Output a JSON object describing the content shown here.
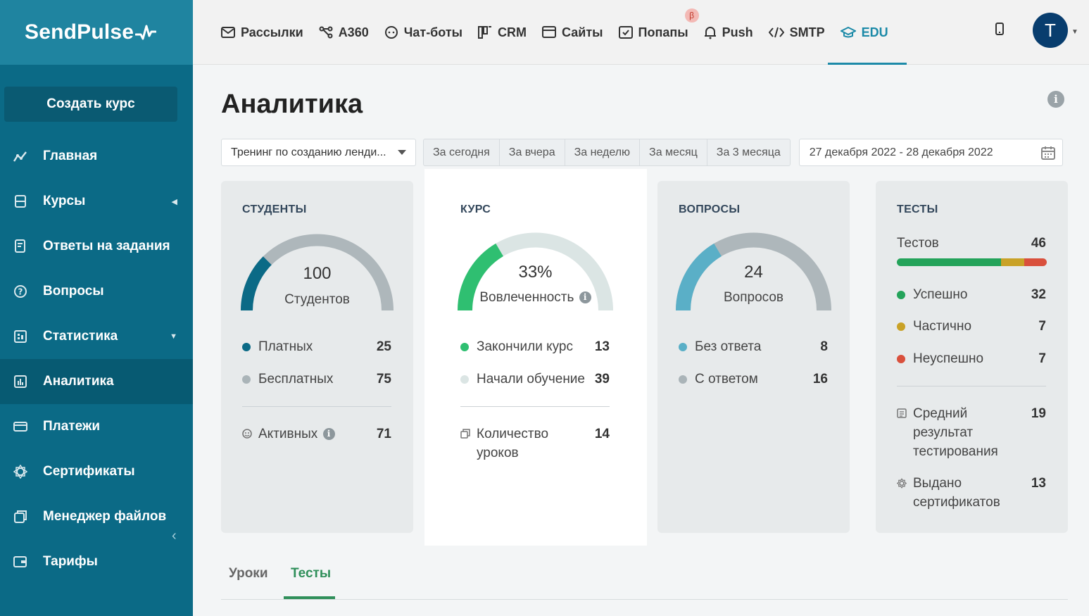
{
  "app": {
    "logo_text": "SendPulse"
  },
  "sidebar": {
    "create_button": "Создать курс",
    "items": [
      {
        "label": "Главная",
        "icon": "chart-line-icon"
      },
      {
        "label": "Курсы",
        "icon": "courses-icon",
        "arrow": "◀"
      },
      {
        "label": "Ответы на задания",
        "icon": "assignment-icon"
      },
      {
        "label": "Вопросы",
        "icon": "question-icon"
      },
      {
        "label": "Статистика",
        "icon": "statistics-icon",
        "arrow": "▼"
      },
      {
        "label": "Аналитика",
        "icon": "analytics-icon",
        "active": true
      },
      {
        "label": "Платежи",
        "icon": "payments-icon"
      },
      {
        "label": "Сертификаты",
        "icon": "certificate-icon"
      },
      {
        "label": "Менеджер файлов",
        "icon": "files-icon"
      },
      {
        "label": "Тарифы",
        "icon": "wallet-icon"
      }
    ]
  },
  "topnav": {
    "items": [
      {
        "label": "Рассылки",
        "icon": "mail-icon"
      },
      {
        "label": "A360",
        "icon": "automation-icon"
      },
      {
        "label": "Чат-боты",
        "icon": "chatbot-icon"
      },
      {
        "label": "CRM",
        "icon": "crm-icon"
      },
      {
        "label": "Сайты",
        "icon": "sites-icon"
      },
      {
        "label": "Попапы",
        "icon": "popup-icon",
        "badge": "β"
      },
      {
        "label": "Push",
        "icon": "bell-icon"
      },
      {
        "label": "SMTP",
        "icon": "code-icon"
      },
      {
        "label": "EDU",
        "icon": "graduation-cap-icon",
        "active": true
      }
    ],
    "avatar_letter": "T"
  },
  "page": {
    "title": "Аналитика",
    "course_select_value": "Тренинг по созданию ленди...",
    "periods": [
      "За сегодня",
      "За вчера",
      "За неделю",
      "За месяц",
      "За 3 месяца"
    ],
    "date_range": "27 декабря 2022 - 28 декабря 2022"
  },
  "cards": {
    "students": {
      "title": "СТУДЕНТЫ",
      "gauge_value": "100",
      "gauge_label": "Студентов",
      "gauge_fraction": 0.25,
      "rows": [
        {
          "label": "Платных",
          "value": "25",
          "color": "#0b6a86"
        },
        {
          "label": "Бесплатных",
          "value": "75",
          "color": "#aab4b8"
        }
      ],
      "active_label": "Активных",
      "active_value": "71"
    },
    "course": {
      "title": "КУРС",
      "gauge_value": "33%",
      "gauge_label": "Вовлеченность",
      "gauge_fraction": 0.33,
      "rows": [
        {
          "label": "Закончили курс",
          "value": "13",
          "color": "#2fbf71"
        },
        {
          "label": "Начали обучение",
          "value": "39",
          "color": "#dbe5e4"
        }
      ],
      "lessons_label": "Количество уроков",
      "lessons_value": "14"
    },
    "questions": {
      "title": "ВОПРОСЫ",
      "gauge_value": "24",
      "gauge_label": "Вопросов",
      "gauge_fraction": 0.33,
      "rows": [
        {
          "label": "Без ответа",
          "value": "8",
          "color": "#5aafc7"
        },
        {
          "label": "С ответом",
          "value": "16",
          "color": "#aab4b8"
        }
      ]
    },
    "tests": {
      "title": "ТЕСТЫ",
      "total_label": "Тестов",
      "total_value": "46",
      "rows": [
        {
          "label": "Успешно",
          "value": "32",
          "color": "#24a35a"
        },
        {
          "label": "Частично",
          "value": "7",
          "color": "#c9a227"
        },
        {
          "label": "Неуспешно",
          "value": "7",
          "color": "#d9503c"
        }
      ],
      "avg_label": "Средний результат тестирования",
      "avg_value": "19",
      "certs_label": "Выдано сертификатов",
      "certs_value": "13"
    }
  },
  "tabs": [
    {
      "label": "Уроки"
    },
    {
      "label": "Тесты",
      "active": true
    }
  ]
}
